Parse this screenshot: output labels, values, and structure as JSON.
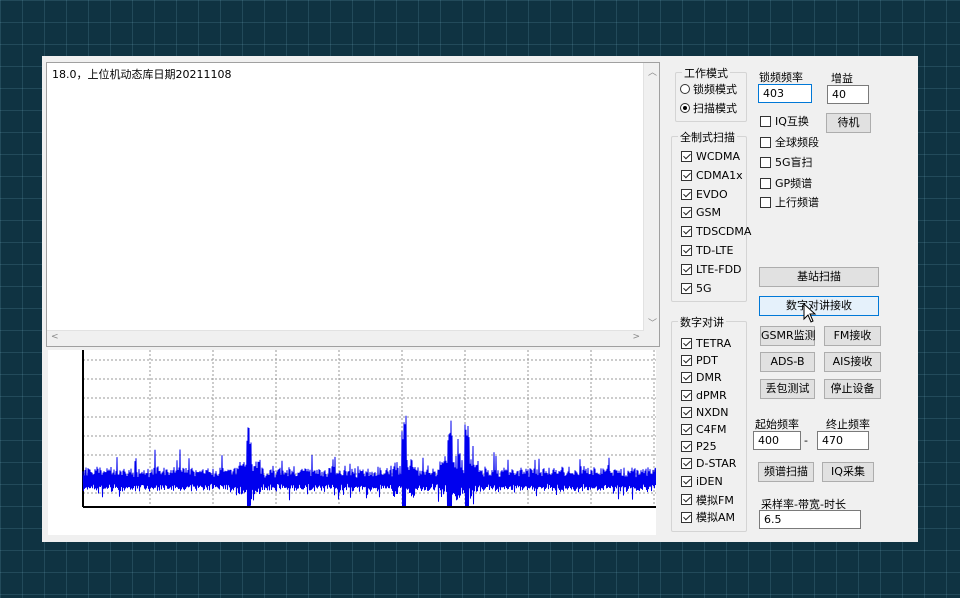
{
  "log": {
    "text": "18.0，上位机动态库日期20211108"
  },
  "work_mode": {
    "title": "工作模式",
    "options": [
      {
        "label": "锁频模式",
        "selected": false
      },
      {
        "label": "扫描模式",
        "selected": true
      }
    ]
  },
  "fullscan": {
    "title": "全制式扫描",
    "items": [
      {
        "label": "WCDMA",
        "checked": true
      },
      {
        "label": "CDMA1x",
        "checked": true
      },
      {
        "label": "EVDO",
        "checked": true
      },
      {
        "label": "GSM",
        "checked": true
      },
      {
        "label": "TDSCDMA",
        "checked": true
      },
      {
        "label": "TD-LTE",
        "checked": true
      },
      {
        "label": "LTE-FDD",
        "checked": true
      },
      {
        "label": "5G",
        "checked": true
      }
    ]
  },
  "digital": {
    "title": "数字对讲",
    "items": [
      {
        "label": "TETRA",
        "checked": true
      },
      {
        "label": "PDT",
        "checked": true
      },
      {
        "label": "DMR",
        "checked": true
      },
      {
        "label": "dPMR",
        "checked": true
      },
      {
        "label": "NXDN",
        "checked": true
      },
      {
        "label": "C4FM",
        "checked": true
      },
      {
        "label": "P25",
        "checked": true
      },
      {
        "label": "D-STAR",
        "checked": true
      },
      {
        "label": "iDEN",
        "checked": true
      },
      {
        "label": "模拟FM",
        "checked": true
      },
      {
        "label": "模拟AM",
        "checked": true
      }
    ]
  },
  "lock_freq": {
    "label": "锁频频率",
    "value": "403"
  },
  "gain": {
    "label": "增益",
    "value": "40"
  },
  "options": [
    {
      "label": "IQ互换",
      "checked": false
    },
    {
      "label": "全球频段",
      "checked": false
    },
    {
      "label": "5G盲扫",
      "checked": false
    },
    {
      "label": "GP频谱",
      "checked": false
    },
    {
      "label": "上行频谱",
      "checked": false
    }
  ],
  "buttons": {
    "standby": "待机",
    "base_scan": "基站扫描",
    "digital_rx": "数字对讲接收",
    "gsmr": "GSMR监测",
    "fm_rx": "FM接收",
    "adsb": "ADS-B",
    "ais_rx": "AIS接收",
    "packet_test": "丢包测试",
    "stop": "停止设备",
    "spectrum_scan": "频谱扫描",
    "iq_capture": "IQ采集"
  },
  "freq_range": {
    "start_label": "起始频率",
    "stop_label": "终止频率",
    "start": "400",
    "stop": "470",
    "dash": "-"
  },
  "sample": {
    "label": "采样率-带宽-时长",
    "value": "6.5"
  },
  "chart_data": {
    "type": "line",
    "series": [
      {
        "color": "#0000ee"
      }
    ],
    "peaks_relative": [
      0.29,
      0.56,
      0.64,
      0.67
    ],
    "grid": true
  }
}
